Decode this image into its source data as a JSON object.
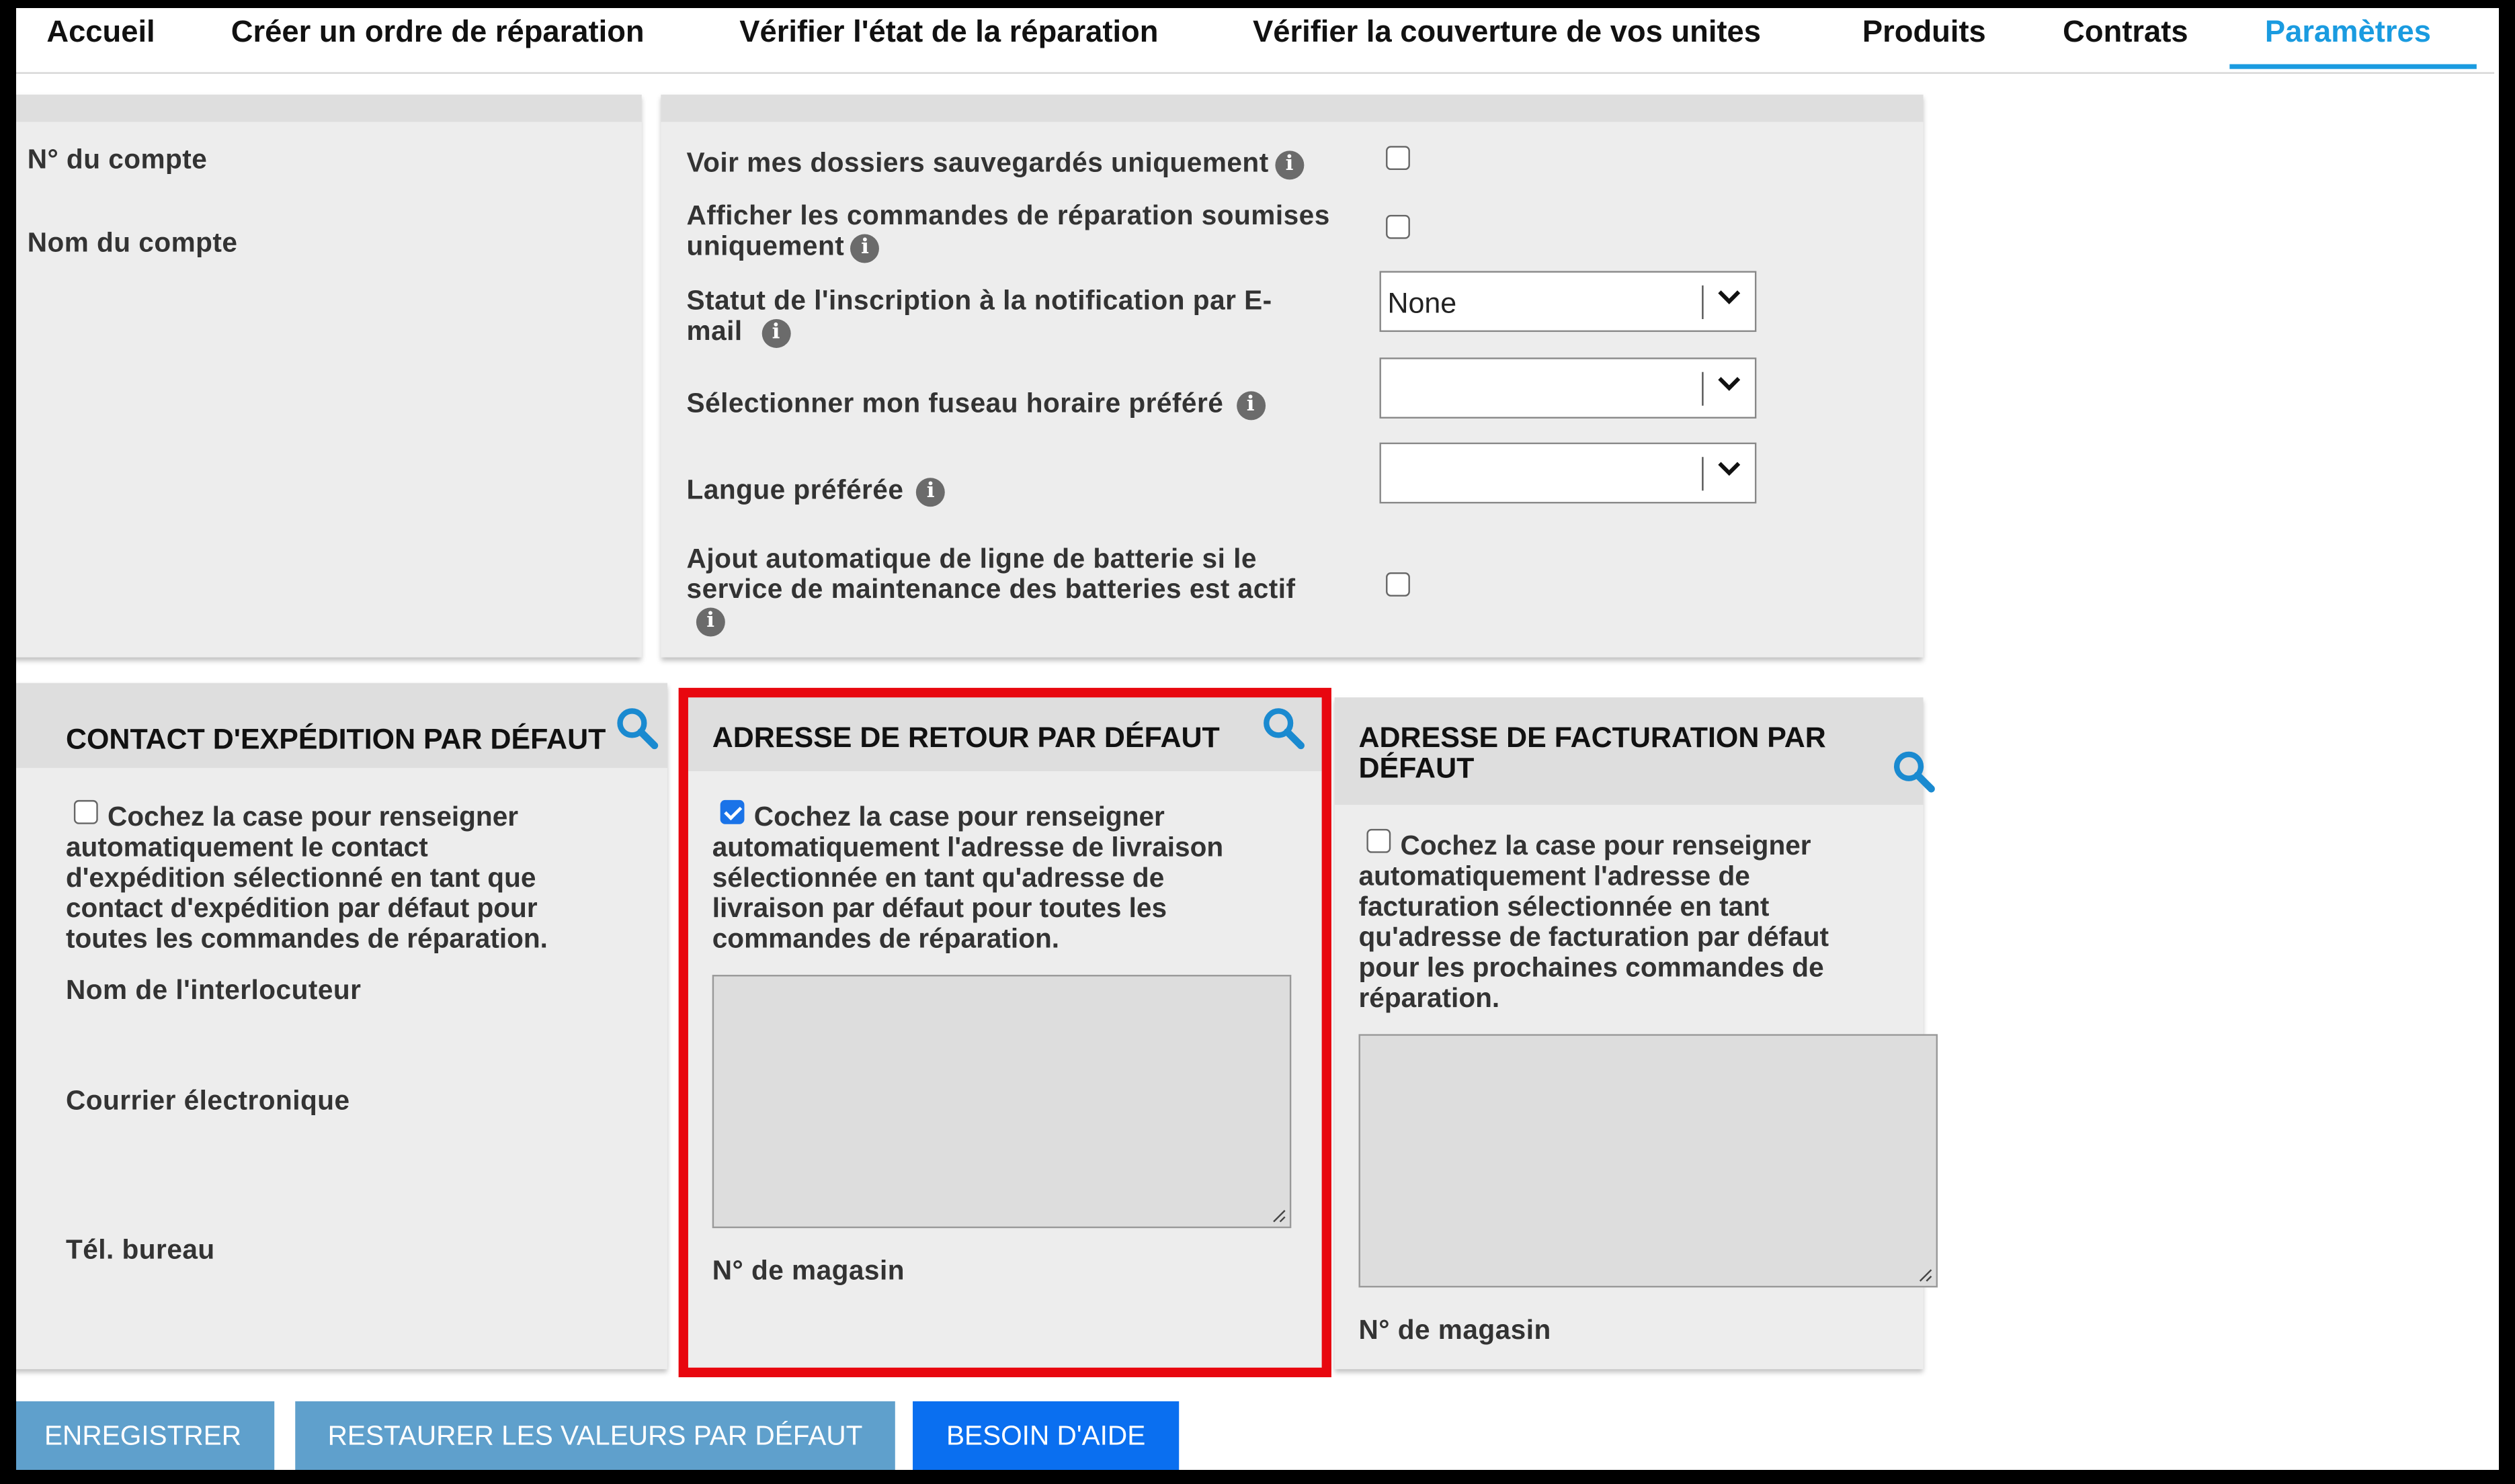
{
  "nav": {
    "tabs": [
      {
        "label": "Accueil"
      },
      {
        "label": "Créer un ordre de réparation"
      },
      {
        "label": "Vérifier l'état de la réparation"
      },
      {
        "label": "Vérifier la couverture de vos unites"
      },
      {
        "label": "Produits"
      },
      {
        "label": "Contrats"
      },
      {
        "label": "Paramètres",
        "active": true
      }
    ]
  },
  "account": {
    "number_label": "N° du compte",
    "name_label": "Nom du compte"
  },
  "preferences": {
    "saved_files_label": "Voir mes dossiers sauvegardés uniquement",
    "submitted_orders_label_1": "Afficher les commandes de réparation soumises",
    "submitted_orders_label_2": "uniquement",
    "email_status_label_1": "Statut de l'inscription à la notification par E-",
    "email_status_label_2": "mail",
    "email_status_value": "None",
    "timezone_label": "Sélectionner mon fuseau horaire préféré",
    "timezone_value": "",
    "language_label": "Langue préférée",
    "language_value": "",
    "battery_label_1": "Ajout automatique de ligne de batterie si le",
    "battery_label_2": "service de maintenance des batteries est actif",
    "saved_files_checked": false,
    "submitted_orders_checked": false,
    "battery_checked": false
  },
  "shipping_contact": {
    "title": "CONTACT D'EXPÉDITION PAR DÉFAUT",
    "checkbox_text": [
      "Cochez la case pour renseigner",
      "automatiquement le contact",
      "d'expédition sélectionné en tant que",
      "contact d'expédition par défaut pour",
      "toutes les commandes de réparation."
    ],
    "checked": false,
    "contact_name_label": "Nom de l'interlocuteur",
    "email_label": "Courrier électronique",
    "phone_label": "Tél. bureau"
  },
  "return_address": {
    "title": "ADRESSE DE RETOUR PAR DÉFAUT",
    "checkbox_text": [
      "Cochez la case pour renseigner",
      "automatiquement l'adresse de livraison",
      "sélectionnée en tant qu'adresse de",
      "livraison par défaut pour toutes les",
      "commandes de réparation."
    ],
    "checked": true,
    "address_value": "",
    "store_label": "N° de magasin"
  },
  "billing_address": {
    "title_1": "ADRESSE DE FACTURATION PAR",
    "title_2": "DÉFAUT",
    "checkbox_text": [
      "Cochez la case pour renseigner",
      "automatiquement l'adresse de",
      "facturation sélectionnée en tant",
      "qu'adresse de facturation par défaut",
      "pour les prochaines commandes de",
      "réparation."
    ],
    "checked": false,
    "address_value": "",
    "store_label": "N° de magasin"
  },
  "buttons": {
    "save": "ENREGISTRER",
    "restore": "RESTAURER LES VALEURS PAR DÉFAUT",
    "help": "BESOIN D'AIDE"
  },
  "colors": {
    "accent": "#1a9be0",
    "highlight": "#e8070f",
    "button_muted": "#5fa0cc",
    "button_primary": "#0a6ff0"
  },
  "icons": [
    "info-icon",
    "search-icon",
    "chevron-down-icon",
    "checkbox",
    "resize-grip-icon"
  ]
}
